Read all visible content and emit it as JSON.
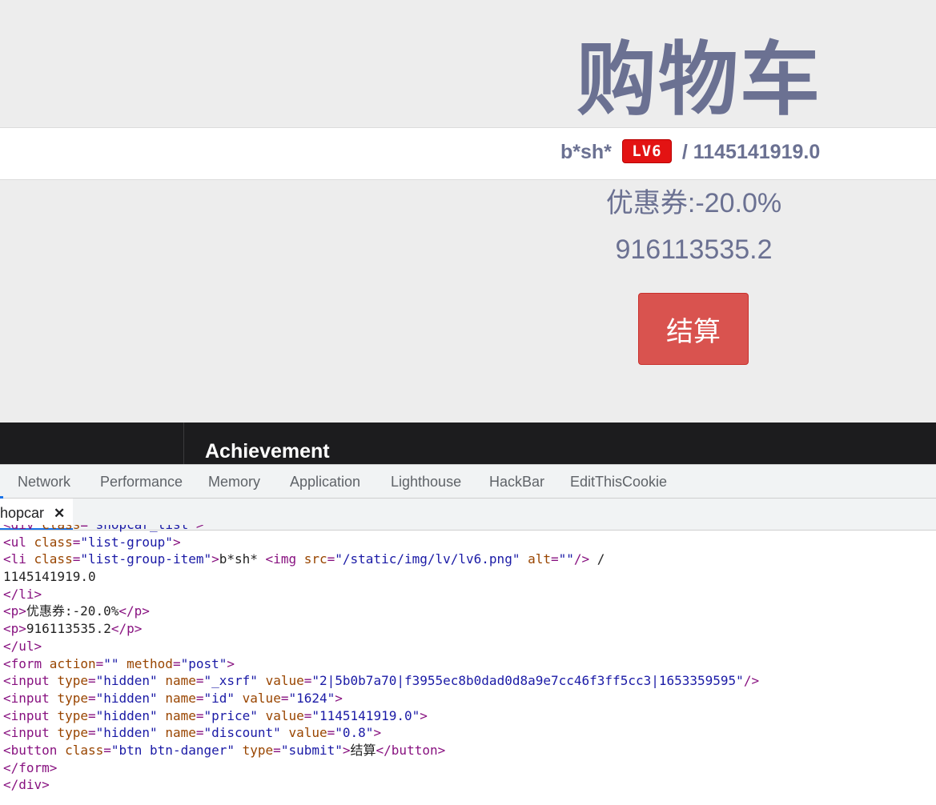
{
  "page": {
    "title": "购物车",
    "user": {
      "name": "b*sh*",
      "level_badge": "LV6",
      "separator": "/",
      "balance": "1145141919.0"
    },
    "coupon": "优惠券:-20.0%",
    "total": "916113535.2",
    "checkout_label": "结算"
  },
  "dark_strip": {
    "heading": "Achievement"
  },
  "devtools": {
    "tabs": [
      "Network",
      "Performance",
      "Memory",
      "Application",
      "Lighthouse",
      "HackBar",
      "EditThisCookie"
    ],
    "file_tab": "hopcar",
    "close_glyph": "✕",
    "code_lines": [
      [
        [
          "tag",
          "<div "
        ],
        [
          "attr",
          "class"
        ],
        [
          "tag",
          "="
        ],
        [
          "val",
          "\"shopcar_list\""
        ],
        [
          "tag",
          ">"
        ]
      ],
      [
        [
          "tag",
          "<ul "
        ],
        [
          "attr",
          "class"
        ],
        [
          "tag",
          "="
        ],
        [
          "val",
          "\"list-group\""
        ],
        [
          "tag",
          ">"
        ]
      ],
      [
        [
          "tag",
          "<li "
        ],
        [
          "attr",
          "class"
        ],
        [
          "tag",
          "="
        ],
        [
          "val",
          "\"list-group-item\""
        ],
        [
          "tag",
          ">"
        ],
        [
          "txt",
          "b*sh* "
        ],
        [
          "tag",
          "<img "
        ],
        [
          "attr",
          "src"
        ],
        [
          "tag",
          "="
        ],
        [
          "val",
          "\"/static/img/lv/lv6.png\""
        ],
        [
          "tag",
          " "
        ],
        [
          "attr",
          "alt"
        ],
        [
          "tag",
          "="
        ],
        [
          "val",
          "\"\""
        ],
        [
          "tag",
          "/>"
        ],
        [
          "txt",
          " /"
        ]
      ],
      [
        [
          "txt",
          "1145141919.0"
        ]
      ],
      [
        [
          "tag",
          "</li>"
        ]
      ],
      [
        [
          "tag",
          "<p>"
        ],
        [
          "txt",
          "优惠券:-20.0%"
        ],
        [
          "tag",
          "</p>"
        ]
      ],
      [
        [
          "tag",
          "<p>"
        ],
        [
          "txt",
          "916113535.2"
        ],
        [
          "tag",
          "</p>"
        ]
      ],
      [
        [
          "tag",
          "</ul>"
        ]
      ],
      [
        [
          "tag",
          "<form "
        ],
        [
          "attr",
          "action"
        ],
        [
          "tag",
          "="
        ],
        [
          "val",
          "\"\""
        ],
        [
          "tag",
          " "
        ],
        [
          "attr",
          "method"
        ],
        [
          "tag",
          "="
        ],
        [
          "val",
          "\"post\""
        ],
        [
          "tag",
          ">"
        ]
      ],
      [
        [
          "tag",
          "<input "
        ],
        [
          "attr",
          "type"
        ],
        [
          "tag",
          "="
        ],
        [
          "val",
          "\"hidden\""
        ],
        [
          "tag",
          " "
        ],
        [
          "attr",
          "name"
        ],
        [
          "tag",
          "="
        ],
        [
          "val",
          "\"_xsrf\""
        ],
        [
          "tag",
          " "
        ],
        [
          "attr",
          "value"
        ],
        [
          "tag",
          "="
        ],
        [
          "val",
          "\"2|5b0b7a70|f3955ec8b0dad0d8a9e7cc46f3ff5cc3|1653359595\""
        ],
        [
          "tag",
          "/>"
        ]
      ],
      [
        [
          "tag",
          "<input "
        ],
        [
          "attr",
          "type"
        ],
        [
          "tag",
          "="
        ],
        [
          "val",
          "\"hidden\""
        ],
        [
          "tag",
          " "
        ],
        [
          "attr",
          "name"
        ],
        [
          "tag",
          "="
        ],
        [
          "val",
          "\"id\""
        ],
        [
          "tag",
          " "
        ],
        [
          "attr",
          "value"
        ],
        [
          "tag",
          "="
        ],
        [
          "val",
          "\"1624\""
        ],
        [
          "tag",
          ">"
        ]
      ],
      [
        [
          "tag",
          "<input "
        ],
        [
          "attr",
          "type"
        ],
        [
          "tag",
          "="
        ],
        [
          "val",
          "\"hidden\""
        ],
        [
          "tag",
          " "
        ],
        [
          "attr",
          "name"
        ],
        [
          "tag",
          "="
        ],
        [
          "val",
          "\"price\""
        ],
        [
          "tag",
          " "
        ],
        [
          "attr",
          "value"
        ],
        [
          "tag",
          "="
        ],
        [
          "val",
          "\"1145141919.0\""
        ],
        [
          "tag",
          ">"
        ]
      ],
      [
        [
          "tag",
          "<input "
        ],
        [
          "attr",
          "type"
        ],
        [
          "tag",
          "="
        ],
        [
          "val",
          "\"hidden\""
        ],
        [
          "tag",
          " "
        ],
        [
          "attr",
          "name"
        ],
        [
          "tag",
          "="
        ],
        [
          "val",
          "\"discount\""
        ],
        [
          "tag",
          " "
        ],
        [
          "attr",
          "value"
        ],
        [
          "tag",
          "="
        ],
        [
          "val",
          "\"0.8\""
        ],
        [
          "tag",
          ">"
        ]
      ],
      [
        [
          "tag",
          "<button "
        ],
        [
          "attr",
          "class"
        ],
        [
          "tag",
          "="
        ],
        [
          "val",
          "\"btn btn-danger\""
        ],
        [
          "tag",
          " "
        ],
        [
          "attr",
          "type"
        ],
        [
          "tag",
          "="
        ],
        [
          "val",
          "\"submit\""
        ],
        [
          "tag",
          ">"
        ],
        [
          "txt",
          "结算"
        ],
        [
          "tag",
          "</button>"
        ]
      ],
      [
        [
          "tag",
          "</form>"
        ]
      ],
      [
        [
          "tag",
          "</div>"
        ]
      ]
    ]
  },
  "colors": {
    "title": "#6b7192",
    "danger": "#d9534f",
    "badge": "#e31313",
    "dark_strip": "#1c1c1e"
  }
}
